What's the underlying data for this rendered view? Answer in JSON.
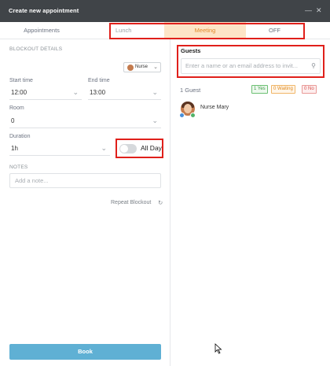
{
  "window": {
    "title": "Create new appointment"
  },
  "tabs": [
    {
      "label": "Appointments"
    },
    {
      "label": "Lunch"
    },
    {
      "label": "Meeting"
    },
    {
      "label": "OFF"
    }
  ],
  "blockout": {
    "section_label": "BLOCKOUT DETAILS",
    "assignee": "Nurse",
    "start_time_label": "Start time",
    "start_time_value": "12:00",
    "end_time_label": "End time",
    "end_time_value": "13:00",
    "room_label": "Room",
    "room_value": "0",
    "duration_label": "Duration",
    "duration_value": "1h",
    "all_day_label": "All Day",
    "all_day_on": false,
    "notes_label": "NOTES",
    "notes_placeholder": "Add a note...",
    "repeat_label": "Repeat Blockout"
  },
  "guests": {
    "title": "Guests",
    "input_placeholder": "Enter a name or an email address to invit...",
    "count_label": "1 Guest",
    "yes_badge": "1 Yes",
    "waiting_badge": "0 Waiting",
    "no_badge": "0 No",
    "list": [
      {
        "name": "Nurse Mary"
      }
    ]
  },
  "footer": {
    "book_label": "Book"
  },
  "colors": {
    "accent": "#5fb0d4",
    "meeting_tab_bg": "#fde5c7",
    "highlight": "#e0201b"
  }
}
